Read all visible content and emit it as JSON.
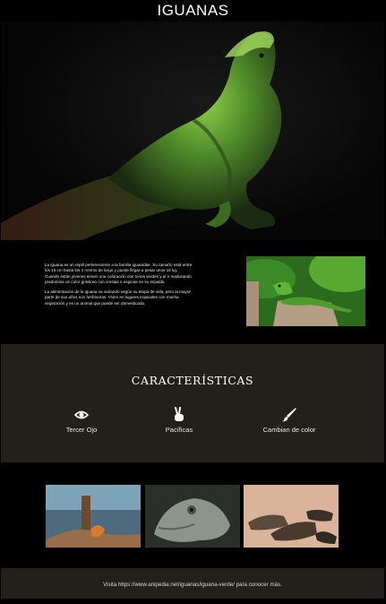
{
  "header": {
    "title": "IGUANAS"
  },
  "about": {
    "paragraphs": [
      "La iguana es un reptil perteneciente a la familia Iguanidae. Su tamaño está entre los 15 cm hasta los 2 metros de largo y puede llegar a pesar unos 15 kg. Cuando están jóvenes tienen una coloración con tonos verdes y al ir madurando predomina un color grisáceo con crestas o espinas en su espalda.",
      "La alimentación de la iguana va variando según su etapa de vida, pero la mayor parte de sus años son herbívoras. Viven en lugares tropicales con mucha vegetación y es un animal que puede ser domesticado."
    ]
  },
  "features": {
    "heading": "CARACTERÍSTICAS",
    "items": [
      {
        "icon": "eye-icon",
        "label": "Tercer Ojo"
      },
      {
        "icon": "peace-hand-icon",
        "label": "Pacíficas"
      },
      {
        "icon": "paint-brush-icon",
        "label": "Cambian de color"
      }
    ]
  },
  "footer": {
    "text": "Visita https://www.anipedia.net/iguanas/iguana-verde/ para conocer más."
  },
  "colors": {
    "page_background": "#000000",
    "section_background": "#231f1a",
    "text": "#ffffff"
  }
}
